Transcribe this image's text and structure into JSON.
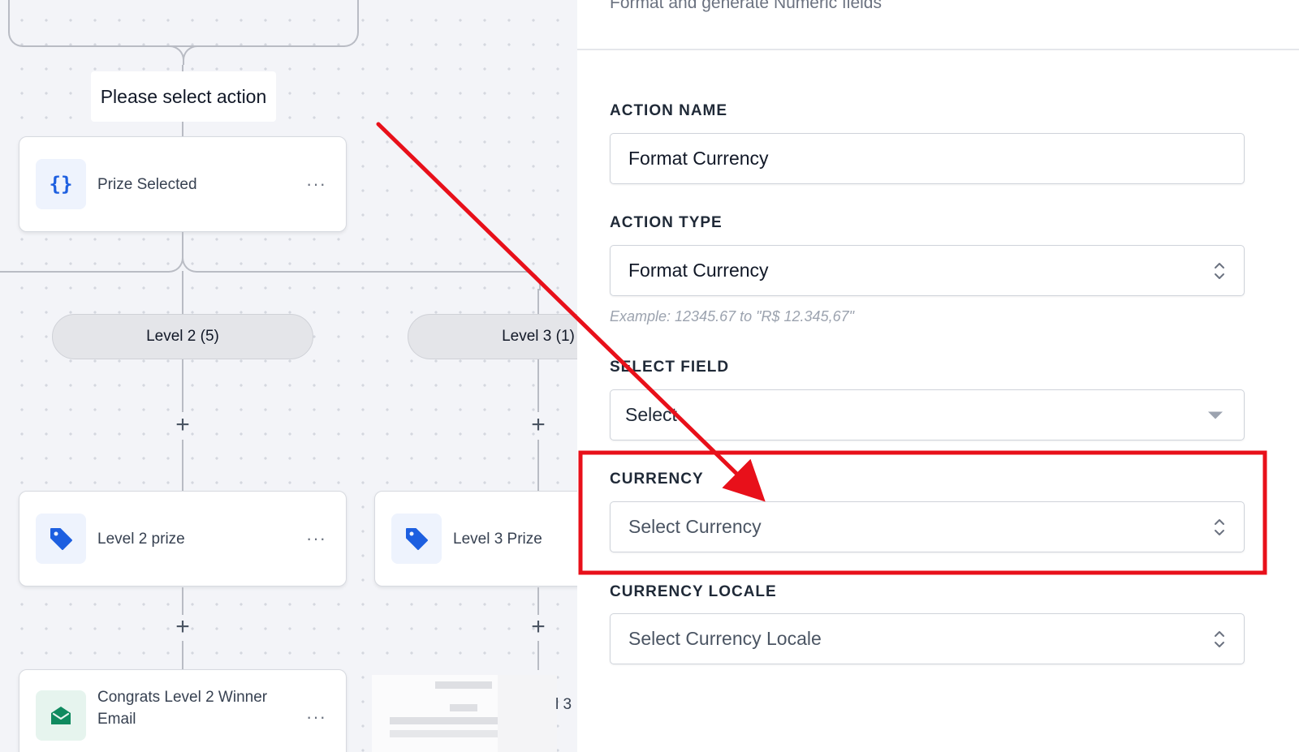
{
  "canvas": {
    "action_label": "Please select action",
    "nodes": {
      "prize_selected": {
        "label": "Prize Selected",
        "icon": "curly-braces-icon"
      },
      "level2_prize": {
        "label": "Level 2 prize",
        "icon": "tag-icon"
      },
      "level3_prize": {
        "label": "Level 3 Prize",
        "icon": "tag-icon"
      },
      "congrats_email": {
        "label": "Congrats Level 2 Winner Email",
        "icon": "envelope-icon"
      }
    },
    "more_glyph": "···",
    "branches": [
      {
        "label": "Level 2 (5)"
      },
      {
        "label": "Level 3 (1)"
      }
    ],
    "plus_glyph": "+",
    "partial_text": "l 3"
  },
  "panel": {
    "subtitle": "Format and generate Numeric fields",
    "action_name": {
      "label": "ACTION NAME",
      "value": "Format Currency"
    },
    "action_type": {
      "label": "ACTION TYPE",
      "value": "Format Currency",
      "hint": "Example: 12345.67 to \"R$ 12.345,67\""
    },
    "select_field": {
      "label": "SELECT FIELD",
      "placeholder": "Select"
    },
    "currency": {
      "label": "CURRENCY",
      "placeholder": "Select Currency"
    },
    "currency_locale": {
      "label": "CURRENCY LOCALE",
      "placeholder": "Select Currency Locale"
    }
  },
  "colors": {
    "annotation_red": "#e8101a",
    "icon_blue": "#1d5fe0",
    "icon_green": "#0f8a5f"
  }
}
